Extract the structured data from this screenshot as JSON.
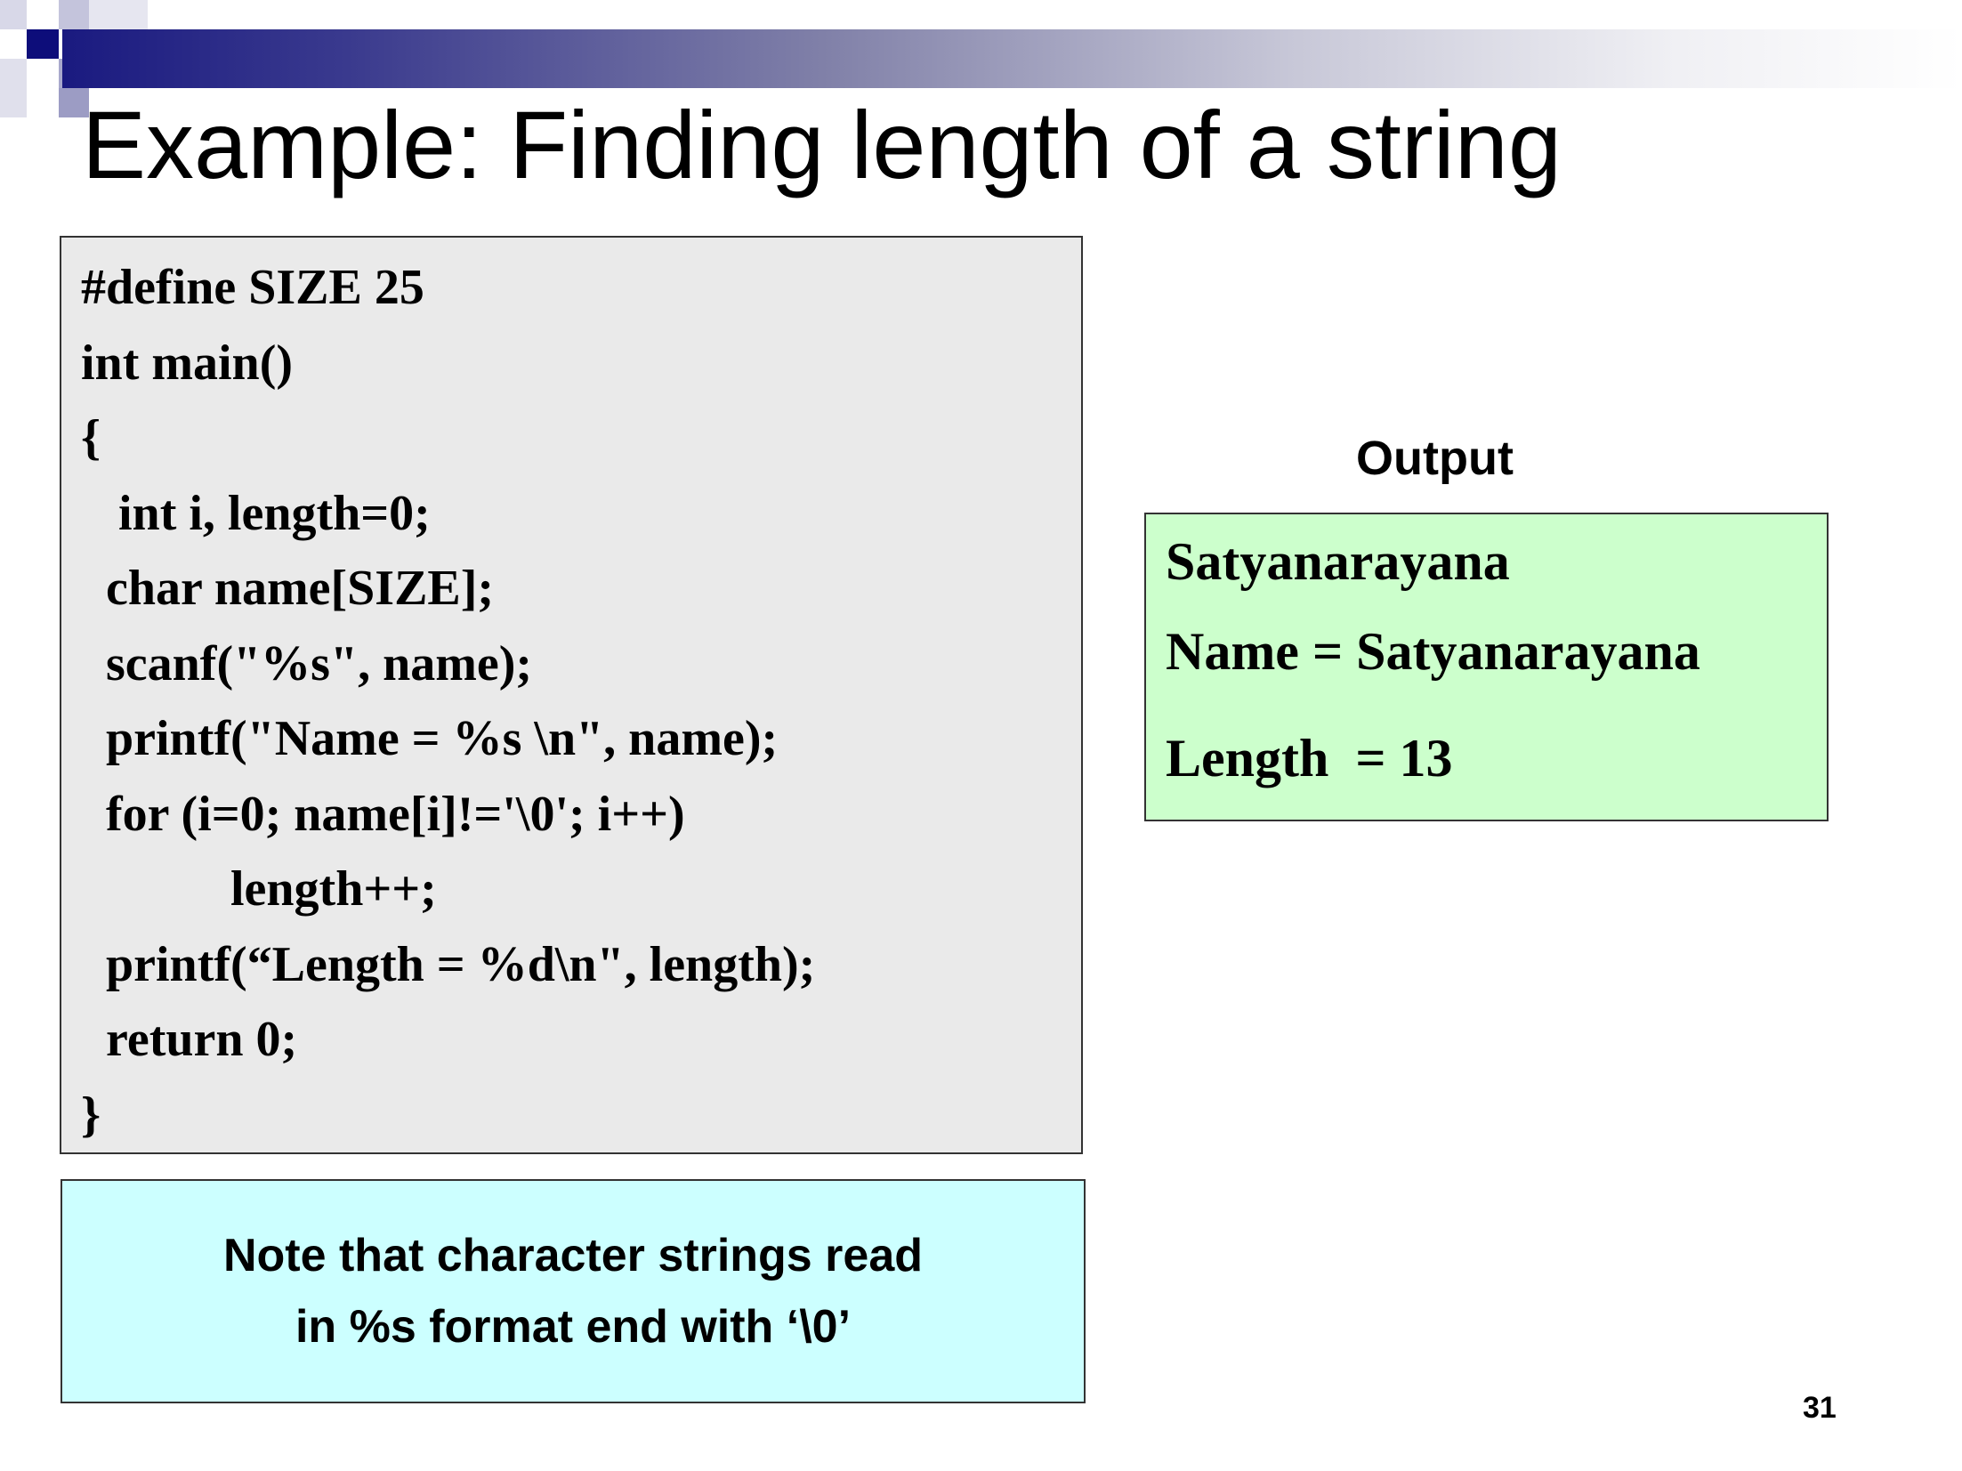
{
  "slide": {
    "title": "Example: Finding length of a string",
    "page_number": "31"
  },
  "code": {
    "lines": [
      "#define SIZE 25",
      "int main()",
      "{",
      "   int i, length=0;",
      "  char name[SIZE];",
      "  scanf(\"%s\", name);",
      "  printf(\"Name = %s \\n\", name);",
      "  for (i=0; name[i]!='\\0'; i++)",
      "            length++;",
      "  printf(“Length = %d\\n\", length);",
      "  return 0;",
      "}"
    ]
  },
  "output": {
    "label": "Output",
    "lines": [
      "Satyanarayana",
      "Name = Satyanarayana",
      "Length  = 13"
    ]
  },
  "note": {
    "lines": [
      "Note that character strings read",
      "in %s format end with ‘\\0’"
    ]
  },
  "colors": {
    "code_bg": "#eaeaea",
    "output_bg": "#ccffcc",
    "note_bg": "#ccffff",
    "banner_dark": "#1a1a80"
  }
}
